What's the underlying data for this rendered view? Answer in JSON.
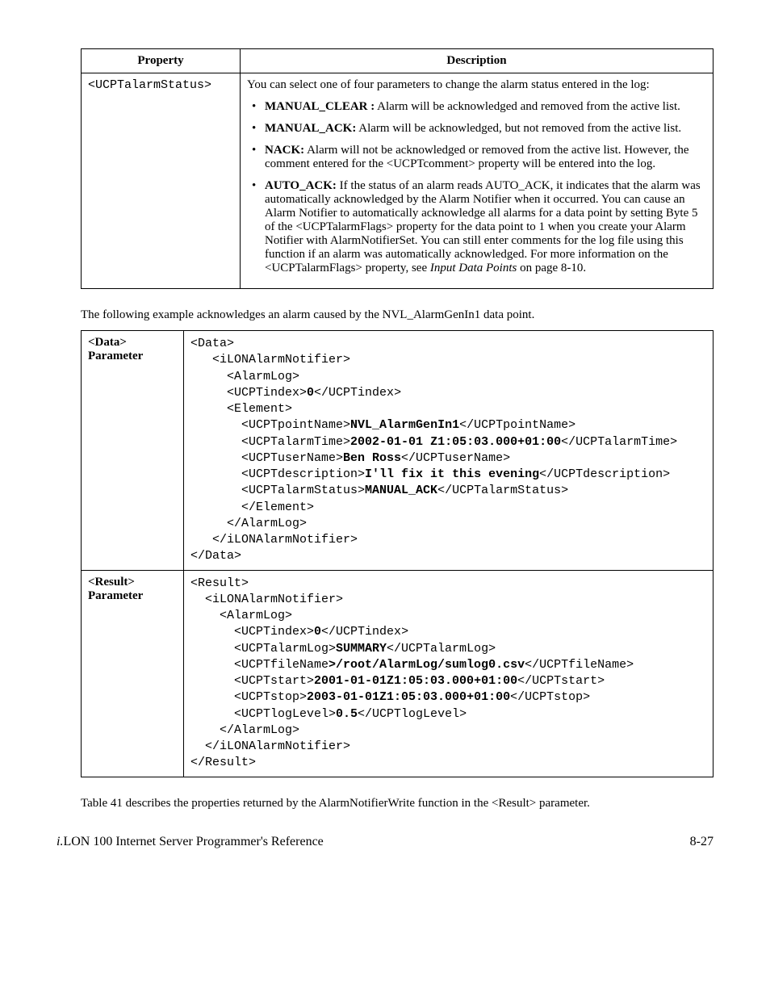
{
  "table": {
    "headers": {
      "prop": "Property",
      "desc": "Description"
    },
    "propName": "<UCPTalarmStatus>",
    "intro": "You can select one of four parameters to change the alarm status entered in the log:",
    "b1_lead": "MANUAL_CLEAR :",
    "b1_rest": " Alarm will be acknowledged and removed from the active list.",
    "b2_lead": "MANUAL_ACK:",
    "b2_rest": " Alarm will be acknowledged, but not removed from the active list.",
    "b3_lead": "NACK:",
    "b3_rest": " Alarm will not be acknowledged or removed from the active list. However, the comment entered for the <UCPTcomment> property will be entered into the log.",
    "b4_lead": "AUTO_ACK:",
    "b4_pre": " If the status of an alarm reads AUTO_ACK, it indicates that the alarm was automatically acknowledged by the Alarm Notifier when it occurred. You can cause an Alarm Notifier to automatically acknowledge all alarms for a data point by setting Byte 5 of the <UCPTalarmFlags> property for the data point to 1 when you create your Alarm Notifier with AlarmNotifierSet. You can still enter comments for the log file using this function if an alarm was automatically acknowledged. For more information on the <UCPTalarmFlags> property, see ",
    "b4_ital": "Input Data Points",
    "b4_post": " on page 8-10."
  },
  "example_intro": "The following example acknowledges an alarm caused by the NVL_AlarmGenIn1 data point.",
  "xml": {
    "dataHdr": "<Data>",
    "paramWord": "Parameter",
    "resultHdr": "<Result>",
    "data": {
      "l01": "<Data>",
      "l02": "   <iLONAlarmNotifier>",
      "l03": "     <AlarmLog>",
      "l04": "     <UCPTindex>",
      "l04b": "0",
      "l04c": "</UCPTindex>",
      "l05": "     <Element>",
      "l06": "       <UCPTpointName>",
      "l06b": "NVL_AlarmGenIn1",
      "l06c": "</UCPTpointName>",
      "l07": "       <UCPTalarmTime>",
      "l07b": "2002-01-01 Z1:05:03.000+01:00",
      "l07c": "</UCPTalarmTime>",
      "l08": "       <UCPTuserName>",
      "l08b": "Ben Ross",
      "l08c": "</UCPTuserName>",
      "l09": "       <UCPTdescription>",
      "l09b": "I'll fix it this evening",
      "l09c": "</UCPTdescription>",
      "l10": "       <UCPTalarmStatus>",
      "l10b": "MANUAL_ACK",
      "l10c": "</UCPTalarmStatus>",
      "l11": "       </Element>",
      "l12": "     </AlarmLog>",
      "l13": "   </iLONAlarmNotifier>",
      "l14": "</Data>"
    },
    "result": {
      "l01": "<Result>",
      "l02": "  <iLONAlarmNotifier>",
      "l03": "    <AlarmLog>",
      "l04": "      <UCPTindex>",
      "l04b": "0",
      "l04c": "</UCPTindex>",
      "l05": "      <UCPTalarmLog>",
      "l05b": "SUMMARY",
      "l05c": "</UCPTalarmLog>",
      "l06": "      <UCPTfileName",
      "l06b": ">/root/AlarmLog/sumlog0.csv",
      "l06c": "</UCPTfileName>",
      "l07": "      <UCPTstart>",
      "l07b": "2001-01-01Z1:05:03.000+01:00",
      "l07c": "</UCPTstart>",
      "l08": "      <UCPTstop>",
      "l08b": "2003-01-01Z1:05:03.000+01:00",
      "l08c": "</UCPTstop>",
      "l09": "      <UCPTlogLevel>",
      "l09b": "0.5",
      "l09c": "</UCPTlogLevel>",
      "l10": "    </AlarmLog>",
      "l11": "  </iLONAlarmNotifier>",
      "l12": "</Result>"
    }
  },
  "closing": "Table 41 describes the properties returned by the AlarmNotifierWrite function in the <Result> parameter.",
  "footer": {
    "i": "i.",
    "title": "LON 100 Internet Server Programmer's Reference",
    "page": "8-27"
  }
}
